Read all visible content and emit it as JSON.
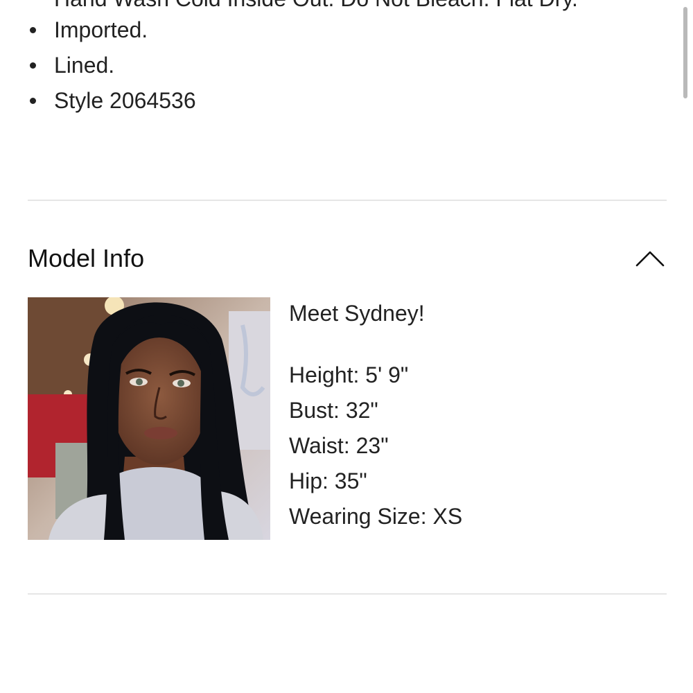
{
  "product_details": {
    "cutoff_line": "Hand Wash Cold Inside Out. Do Not Bleach. Flat Dry.",
    "bullets": [
      "Imported.",
      "Lined.",
      "Style 2064536"
    ]
  },
  "model_info": {
    "title": "Model Info",
    "toggle_icon": "chevron-up-icon",
    "intro": "Meet Sydney!",
    "stats": [
      "Height: 5' 9\"",
      "Bust: 32\"",
      "Waist: 23\"",
      "Hip: 35\"",
      "Wearing Size: XS"
    ]
  },
  "colors": {
    "text": "#222222",
    "divider": "#e6e6e6",
    "background": "#ffffff"
  }
}
